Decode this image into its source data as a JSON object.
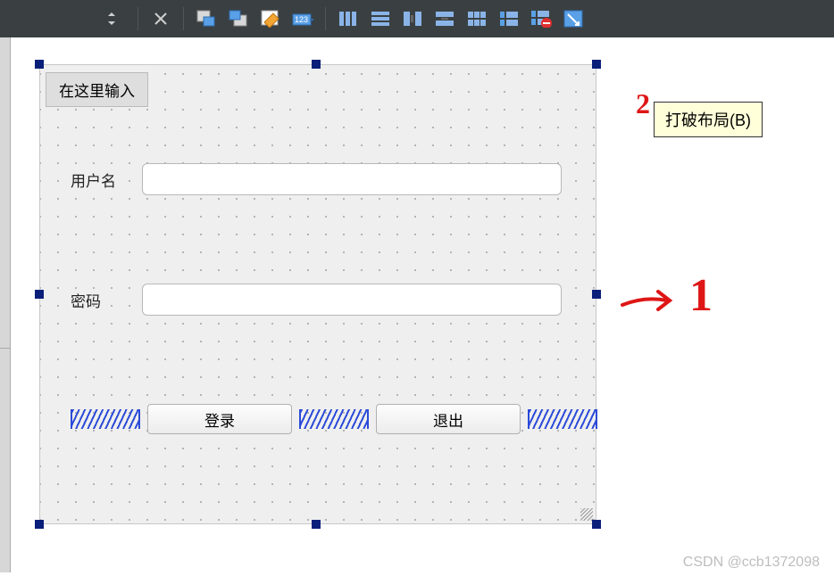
{
  "toolbar": {
    "tooltip": "打破布局(B)"
  },
  "form": {
    "tab_label": "在这里输入",
    "username_label": "用户名",
    "password_label": "密码",
    "login_label": "登录",
    "exit_label": "退出"
  },
  "annotations": {
    "marker_2": "2",
    "marker_1": "1"
  },
  "watermark": "CSDN @ccb1372098"
}
